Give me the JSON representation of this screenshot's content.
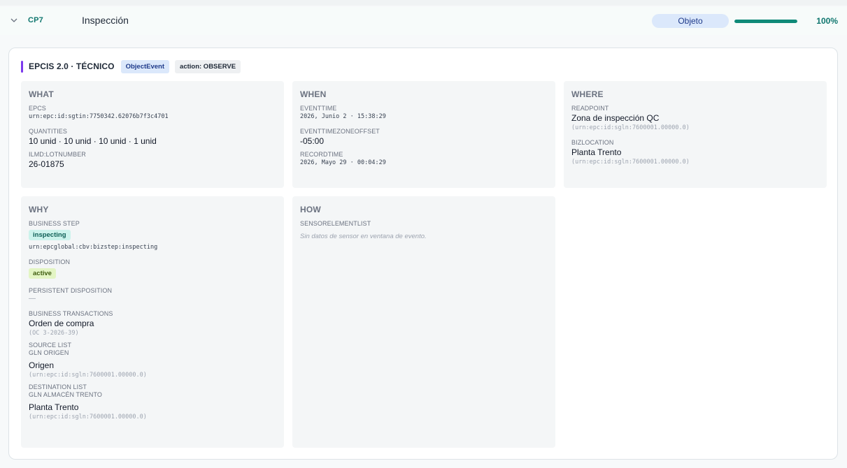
{
  "row": {
    "code": "CP7",
    "title": "Inspección",
    "badge": "Objeto",
    "progress": 1.0,
    "progress_label": "100%"
  },
  "card": {
    "title": "EPCIS 2.0 · TÉCNICO",
    "tag_event": "ObjectEvent",
    "tag_action": "action: OBSERVE"
  },
  "what": {
    "heading": "WHAT",
    "epcs_label": "EPCS",
    "epcs_value": "urn:epc:id:sgtin:7750342.62076b7f3c4701",
    "quantities_label": "QUANTITIES",
    "quantities_value": "10 unid · 10 unid · 10 unid · 1 unid",
    "lot_label": "ILMD:LOTNUMBER",
    "lot_value": "26-01875"
  },
  "when": {
    "heading": "WHEN",
    "eventtime_label": "EVENTTIME",
    "eventtime_value": "2026, Junio 2 · 15:38:29",
    "tz_label": "EVENTTIMEZONEOFFSET",
    "tz_value": "-05:00",
    "recordtime_label": "RECORDTIME",
    "recordtime_value": "2026, Mayo 29 · 00:04:29"
  },
  "where": {
    "heading": "WHERE",
    "readpoint_label": "READPOINT",
    "readpoint_value": "Zona de inspección QC",
    "readpoint_urn": "(urn:epc:id:sgln:7600001.00000.0)",
    "bizlocation_label": "BIZLOCATION",
    "bizlocation_value": "Planta Trento",
    "bizlocation_urn": "(urn:epc:id:sgln:7600001.00000.0)"
  },
  "why": {
    "heading": "WHY",
    "bizstep_label": "BUSINESS STEP",
    "bizstep_badge": "inspecting",
    "bizstep_urn": "urn:epcglobal:cbv:bizstep:inspecting",
    "disposition_label": "DISPOSITION",
    "disposition_badge": "active",
    "persistent_label": "PERSISTENT DISPOSITION",
    "persistent_value": "—",
    "transactions_label": "BUSINESS TRANSACTIONS",
    "transactions_value": "Orden de compra",
    "transactions_ref": "(OC 3-2026-39)",
    "source_label": "SOURCE LIST",
    "source_sub": "GLN ORIGEN",
    "source_value": "Origen",
    "source_urn": "(urn:epc:id:sgln:7600001.00000.0)",
    "dest_label": "DESTINATION LIST",
    "dest_sub": "GLN ALMACÉN TRENTO",
    "dest_value": "Planta Trento",
    "dest_urn": "(urn:epc:id:sgln:7600001.00000.0)"
  },
  "how": {
    "heading": "HOW",
    "sensor_label": "SENSORELEMENTLIST",
    "sensor_empty": "Sin datos de sensor en ventana de evento."
  },
  "colors": {
    "accent": "#7c3aed",
    "progress": "#0f8a78",
    "brand_teal": "#0f766e"
  },
  "icons": {
    "expand": "chevron-down-icon"
  }
}
